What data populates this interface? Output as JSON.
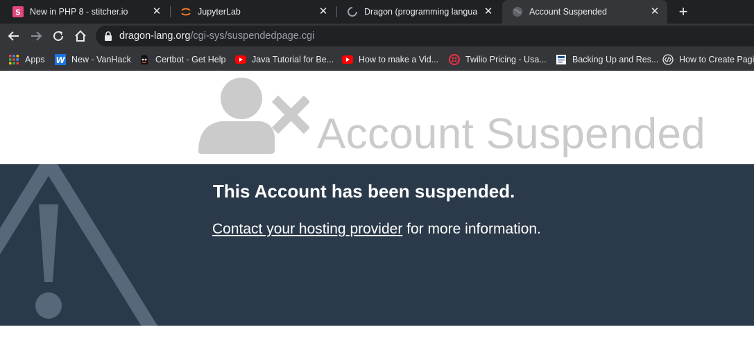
{
  "browser": {
    "tabs": [
      {
        "title": "New in PHP 8 - stitcher.io",
        "icon": "stitcher-favicon-icon",
        "close": "✕"
      },
      {
        "title": "JupyterLab",
        "icon": "jupyter-favicon-icon",
        "close": "✕"
      },
      {
        "title": "Dragon (programming language)",
        "icon": "loading-spinner-icon",
        "close": "✕"
      },
      {
        "title": "Account Suspended",
        "icon": "globe-favicon-icon",
        "close": "✕",
        "active": true
      }
    ],
    "new_tab": "+",
    "url_host": "dragon-lang.org",
    "url_path": "/cgi-sys/suspendedpage.cgi",
    "bookmarks": [
      {
        "label": "Apps",
        "icon": "apps-grid-icon"
      },
      {
        "label": "New - VanHack",
        "icon": "vanhack-icon"
      },
      {
        "label": "Certbot - Get Help",
        "icon": "certbot-icon"
      },
      {
        "label": "Java Tutorial for Be...",
        "icon": "youtube-icon"
      },
      {
        "label": "How to make a Vid...",
        "icon": "youtube-icon"
      },
      {
        "label": "Twilio Pricing - Usa...",
        "icon": "twilio-icon"
      },
      {
        "label": "Backing Up and Res...",
        "icon": "document-icon"
      },
      {
        "label": "How to Create Pagi...",
        "icon": "code-icon"
      }
    ]
  },
  "page": {
    "title": "Account Suspended",
    "heading": "This Account has been suspended.",
    "contact_link": "Contact your hosting provider",
    "contact_suffix": " for more information."
  },
  "colors": {
    "banner": "#2b3a4a",
    "title_gray": "#cbcbcb",
    "warning_gray": "#56687a"
  }
}
